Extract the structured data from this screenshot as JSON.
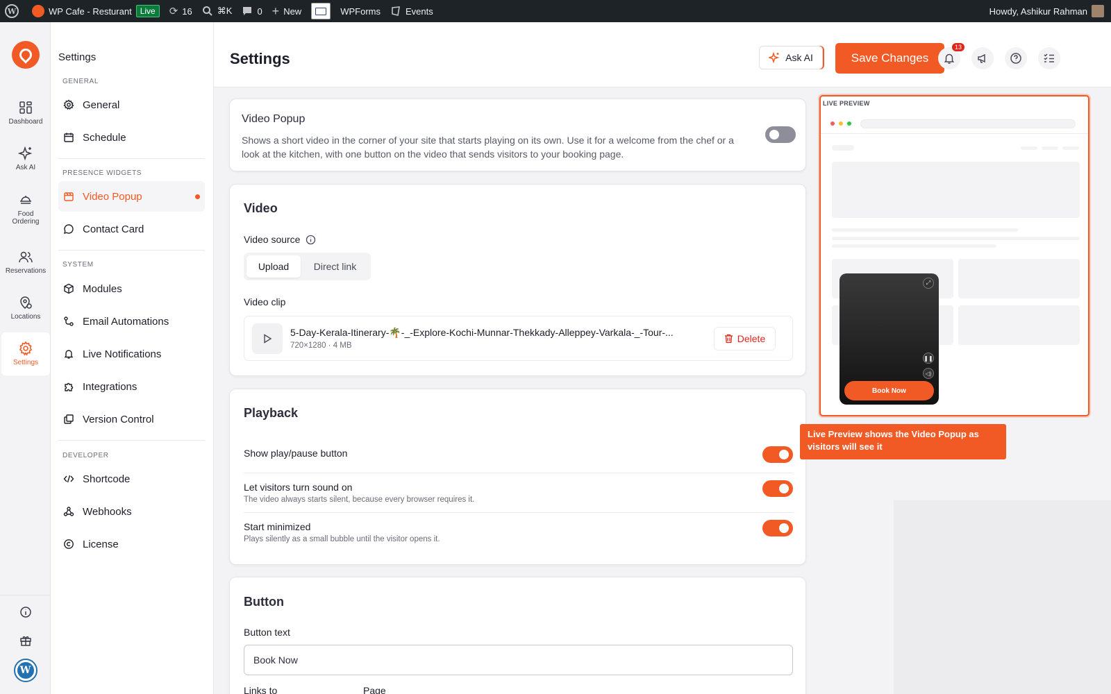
{
  "adminbar": {
    "site_name": "WP Cafe - Resturant",
    "live_badge": "Live",
    "updates_count": "16",
    "search_shortcut": "⌘K",
    "comments_count": "0",
    "new_label": "New",
    "wpforms_label": "WPForms",
    "events_label": "Events",
    "greeting": "Howdy, Ashikur Rahman"
  },
  "rail": {
    "items": [
      {
        "label": "Dashboard",
        "icon": "dashboard-icon"
      },
      {
        "label": "Ask AI",
        "icon": "sparkle-icon"
      },
      {
        "label": "Food Ordering",
        "icon": "food-icon"
      },
      {
        "label": "Reservations",
        "icon": "users-icon"
      },
      {
        "label": "Locations",
        "icon": "location-icon"
      },
      {
        "label": "Settings",
        "icon": "gear-icon",
        "active": true
      }
    ]
  },
  "nav": {
    "title": "Settings",
    "sections": {
      "general": "GENERAL",
      "presence": "PRESENCE WIDGETS",
      "system": "SYSTEM",
      "developer": "DEVELOPER"
    },
    "items": {
      "general": "General",
      "schedule": "Schedule",
      "video_popup": "Video Popup",
      "contact_card": "Contact Card",
      "modules": "Modules",
      "email_automations": "Email Automations",
      "live_notifications": "Live Notifications",
      "integrations": "Integrations",
      "version_control": "Version Control",
      "shortcode": "Shortcode",
      "webhooks": "Webhooks",
      "license": "License"
    }
  },
  "header": {
    "title": "Settings",
    "ask_ai": "Ask AI",
    "save": "Save Changes",
    "notifications_count": "13"
  },
  "intro_card": {
    "title": "Video Popup",
    "description": "Shows a short video in the corner of your site that starts playing on its own. Use it for a welcome from the chef or a look at the kitchen, with one button on the video that sends visitors to your booking page.",
    "enabled": false
  },
  "video_card": {
    "title": "Video",
    "source_label": "Video source",
    "source_options": [
      "Upload",
      "Direct link"
    ],
    "source_selected": "Upload",
    "clip_label": "Video clip",
    "file_name": "5-Day-Kerala-Itinerary-🌴-_-Explore-Kochi-Munnar-Thekkady-Alleppey-Varkala-_-Tour-...",
    "file_meta": "720×1280 · 4 MB",
    "delete": "Delete"
  },
  "playback_card": {
    "title": "Playback",
    "rows": [
      {
        "label": "Show play/pause button",
        "hint": "",
        "on": true
      },
      {
        "label": "Let visitors turn sound on",
        "hint": "The video always starts silent, because every browser requires it.",
        "on": true
      },
      {
        "label": "Start minimized",
        "hint": "Plays silently as a small bubble until the visitor opens it.",
        "on": true
      }
    ]
  },
  "button_card": {
    "title": "Button",
    "text_label": "Button text",
    "text_value": "Book Now",
    "links_to_label": "Links to",
    "page_label": "Page"
  },
  "preview": {
    "label": "LIVE PREVIEW",
    "book_button": "Book Now"
  },
  "tooltip": "Live Preview shows the Video Popup as visitors will see it",
  "colors": {
    "accent": "#f15a24",
    "adminbar": "#1d2327",
    "live_badge": "#0a7b3a",
    "danger": "#e0251b"
  }
}
